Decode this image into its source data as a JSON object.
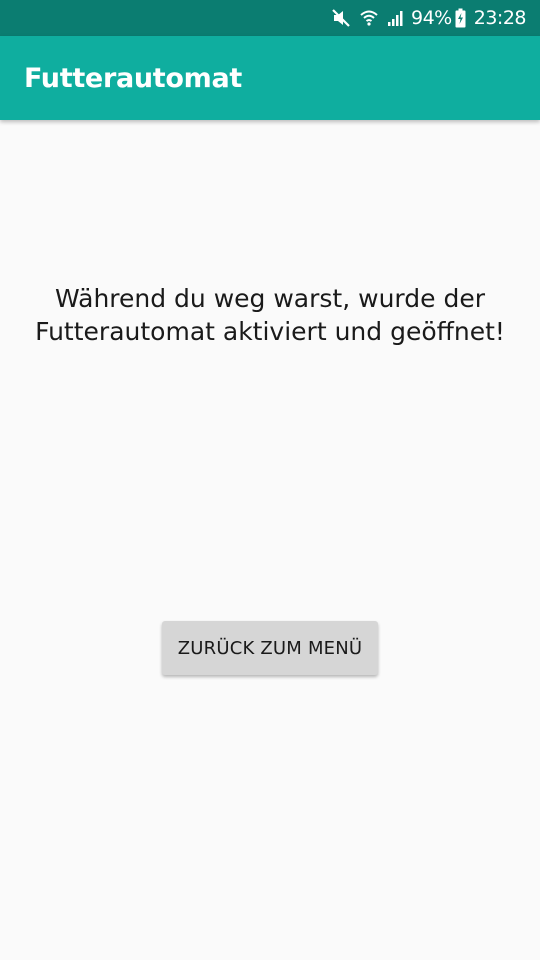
{
  "status_bar": {
    "icons": [
      "mute-icon",
      "wifi-icon",
      "signal-icon"
    ],
    "battery_percent": "94%",
    "battery_icon": "battery-charging-icon",
    "time": "23:28"
  },
  "app_bar": {
    "title": "Futterautomat"
  },
  "message": {
    "line1": "Während du weg warst, wurde der",
    "line2": "Futterautomat aktiviert und geöffnet!"
  },
  "back_button": {
    "label": "ZURÜCK ZUM MENÜ"
  },
  "colors": {
    "status_bar": "#0b7d71",
    "app_bar": "#0fae9f",
    "background": "#fafafa",
    "button": "#d6d6d6"
  }
}
